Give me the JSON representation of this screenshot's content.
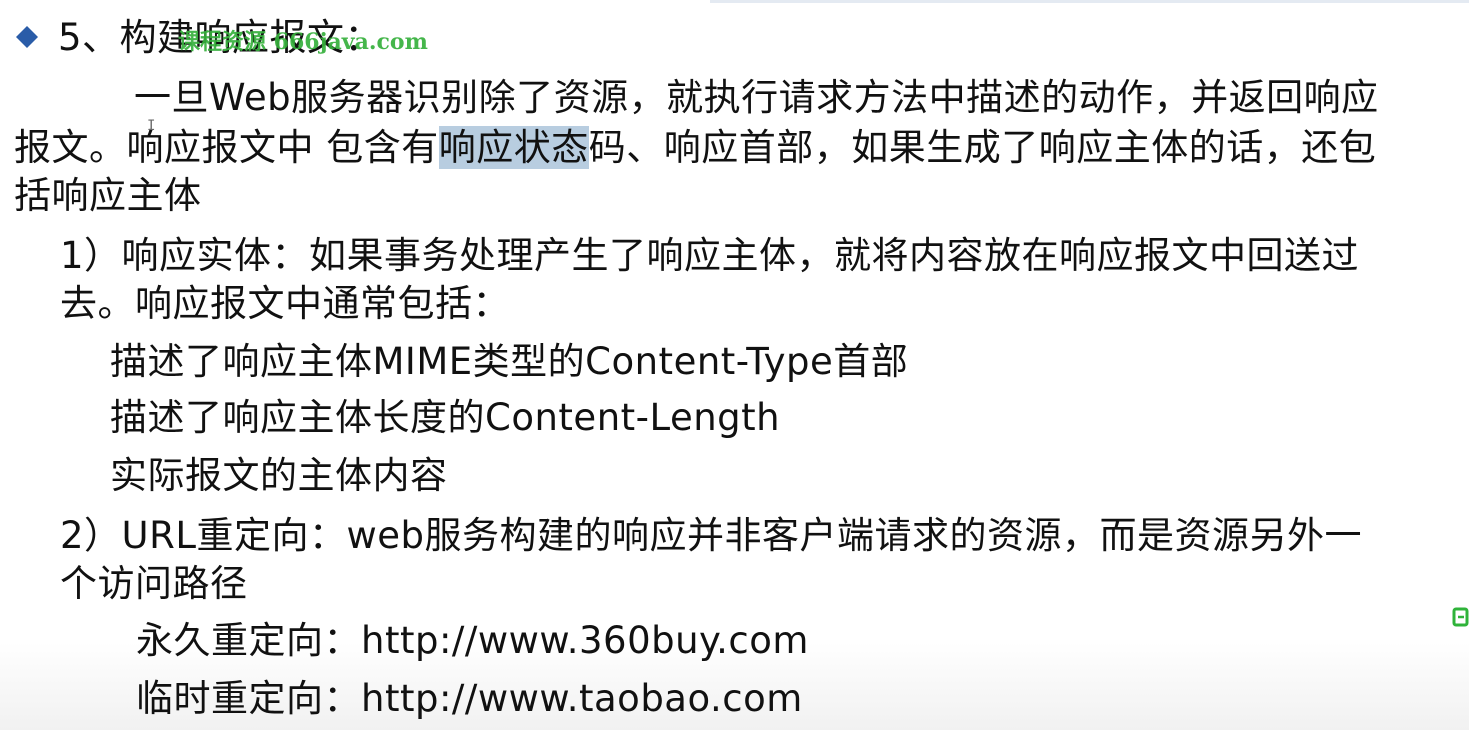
{
  "heading": {
    "bullet_icon": "diamond-bullet-icon",
    "bullet_color": "#2a5ca8",
    "text": "5、构建响应报文："
  },
  "watermark": {
    "text": "课程资源  666java.com",
    "color": "#36b03c"
  },
  "paragraph": {
    "line1": "一旦Web服务器识别除了资源，就执行请求方法中描述的动作，并返回响应",
    "line2_before": "报文。响应报文中 包含有",
    "line2_highlight": "响应状态",
    "line2_after": "码、响应首部，如果生成了响应主体的话，还包",
    "line3": "括响应主体"
  },
  "item1": {
    "line1": "1）响应实体：如果事务处理产生了响应主体，就将内容放在响应报文中回送过",
    "line2": "去。响应报文中通常包括：",
    "sub": [
      "描述了响应主体MIME类型的Content-Type首部",
      "描述了响应主体长度的Content-Length",
      "实际报文的主体内容"
    ]
  },
  "item2": {
    "line1": "2）URL重定向：web服务构建的响应并非客户端请求的资源，而是资源另外一",
    "line2": "个访问路径",
    "sub": [
      "永久重定向：http://www.360buy.com",
      "临时重定向：http://www.taobao.com"
    ]
  },
  "highlight_color": "#b8cde0",
  "side_icon": "green-edge-icon"
}
